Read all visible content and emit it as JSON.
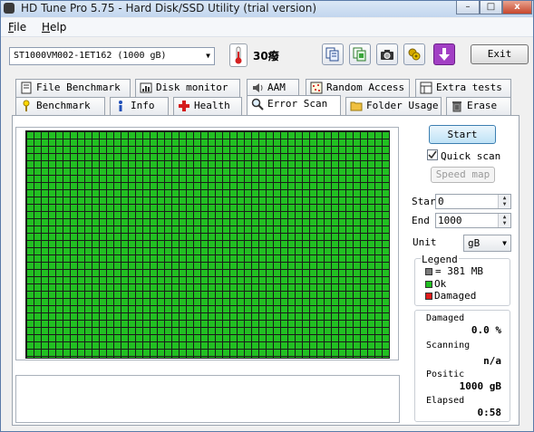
{
  "window": {
    "title": "HD Tune Pro 5.75 - Hard Disk/SSD Utility (trial version)",
    "min_label": "–",
    "max_label": "□",
    "close_label": "x"
  },
  "menu": {
    "file": {
      "mnemonic": "F",
      "rest": "ile"
    },
    "help": {
      "mnemonic": "H",
      "rest": "elp"
    }
  },
  "toolbar": {
    "drive": "ST1000VM002-1ET162  (1000 gB)",
    "temperature": "30癈",
    "exit_label": "Exit",
    "icons": [
      "copy-info-icon",
      "copy-screenshot-icon",
      "camera-icon",
      "options-icon",
      "save-download-icon"
    ]
  },
  "tabs_back": [
    {
      "label": "File Benchmark",
      "icon": "file-benchmark-icon"
    },
    {
      "label": "Disk monitor",
      "icon": "disk-monitor-icon"
    },
    {
      "label": "AAM",
      "icon": "speaker-icon"
    },
    {
      "label": "Random Access",
      "icon": "random-access-icon"
    },
    {
      "label": "Extra tests",
      "icon": "extra-tests-icon"
    }
  ],
  "tabs_front": [
    {
      "label": "Benchmark",
      "icon": "benchmark-icon"
    },
    {
      "label": "Info",
      "icon": "info-icon"
    },
    {
      "label": "Health",
      "icon": "health-cross-icon"
    },
    {
      "label": "Error Scan",
      "icon": "magnifier-icon",
      "active": true
    },
    {
      "label": "Folder Usage",
      "icon": "folder-icon"
    },
    {
      "label": "Erase",
      "icon": "trash-icon"
    }
  ],
  "scan": {
    "start_label": "Start",
    "quick_scan_label": "Quick scan",
    "quick_scan_checked": true,
    "speed_map_label": "Speed map",
    "start_field_label": "Star",
    "start_value": "0",
    "end_field_label": "End",
    "end_value": "1000",
    "unit_label": "Unit",
    "unit_value": "gB"
  },
  "legend": {
    "title": "Legend",
    "block_size": "= 381 MB",
    "ok_label": "Ok",
    "damaged_label": "Damaged",
    "colors": {
      "block": "#7a7a7a",
      "ok": "#22bf22",
      "damaged": "#e01c1c"
    }
  },
  "stats": {
    "damaged_label": "Damaged",
    "damaged_value": "0.0 %",
    "scanning_label": "Scanning",
    "scanning_value": "n/a",
    "position_label": "Positic",
    "position_value": "1000 gB",
    "elapsed_label": "Elapsed",
    "elapsed_value": "0:58"
  }
}
